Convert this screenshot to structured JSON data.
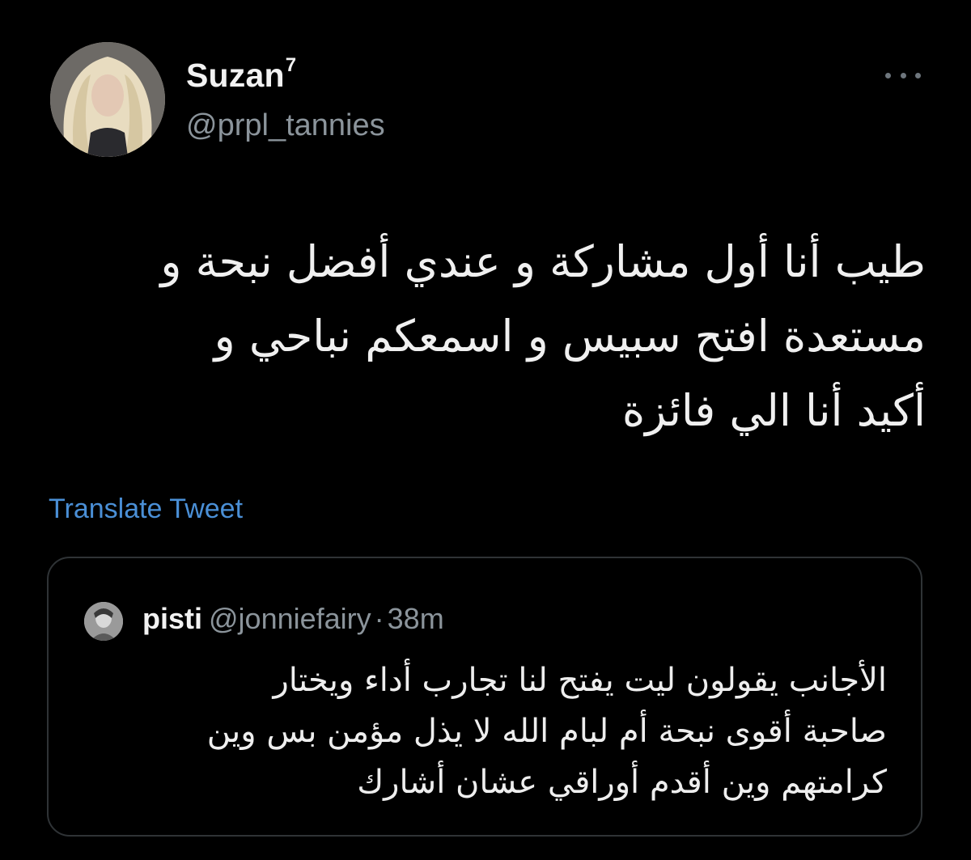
{
  "tweet": {
    "author": {
      "display_name": "Suzan",
      "display_name_suffix": "7",
      "handle": "@prpl_tannies",
      "avatar_icon": "avatar-photo"
    },
    "menu_icon": "more-options-icon",
    "text_lines": [
      "طيب أنا أول مشاركة و عندي أفضل نبحة و",
      "مستعدة افتح سبيس و اسمعكم نباحي و",
      "أكيد أنا الي فائزة"
    ],
    "translate_label": "Translate Tweet"
  },
  "quoted_tweet": {
    "author": {
      "display_name": "pisti",
      "handle": "@jonniefairy",
      "separator": "·",
      "time": "38m",
      "avatar_icon": "avatar-photo"
    },
    "text_lines": [
      "الأجانب يقولون ليت يفتح لنا تجارب أداء ويختار",
      "صاحبة أقوى نبحة أم لبام الله لا يذل مؤمن بس وين",
      "كرامتهم وين أقدم أوراقي عشان أشارك"
    ]
  },
  "colors": {
    "background": "#000000",
    "text_primary": "#e7e9ea",
    "text_secondary": "#8b949b",
    "link": "#4a8fd6",
    "card_border": "#2f3336"
  }
}
